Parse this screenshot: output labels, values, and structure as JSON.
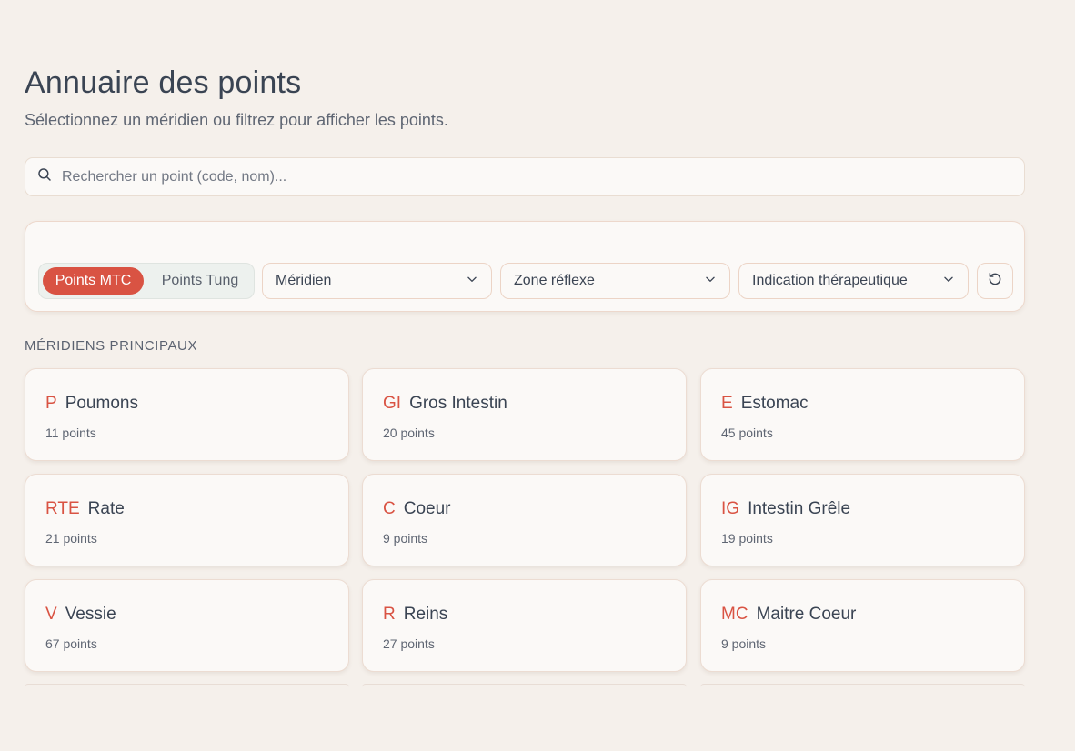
{
  "header": {
    "title": "Annuaire des points",
    "subtitle": "Sélectionnez un méridien ou filtrez pour afficher les points."
  },
  "search": {
    "placeholder": "Rechercher un point (code, nom)...",
    "value": "",
    "icon": "search-icon"
  },
  "filters": {
    "toggle": {
      "active_label": "Points MTC",
      "inactive_label": "Points Tung"
    },
    "meridien_select": "Méridien",
    "zone_select": "Zone réflexe",
    "indication_select": "Indication thérapeutique",
    "reset_icon": "reset-icon"
  },
  "section": {
    "label": "MÉRIDIENS PRINCIPAUX"
  },
  "meridians": [
    {
      "code": "P",
      "name": "Poumons",
      "count": "11 points"
    },
    {
      "code": "GI",
      "name": "Gros Intestin",
      "count": "20 points"
    },
    {
      "code": "E",
      "name": "Estomac",
      "count": "45 points"
    },
    {
      "code": "RTE",
      "name": "Rate",
      "count": "21 points"
    },
    {
      "code": "C",
      "name": "Coeur",
      "count": "9 points"
    },
    {
      "code": "IG",
      "name": "Intestin Grêle",
      "count": "19 points"
    },
    {
      "code": "V",
      "name": "Vessie",
      "count": "67 points"
    },
    {
      "code": "R",
      "name": "Reins",
      "count": "27 points"
    },
    {
      "code": "MC",
      "name": "Maitre Coeur",
      "count": "9 points"
    }
  ],
  "colors": {
    "accent": "#d95343",
    "background": "#f5f0eb",
    "card": "#fbf9f7",
    "text": "#3a4453"
  }
}
